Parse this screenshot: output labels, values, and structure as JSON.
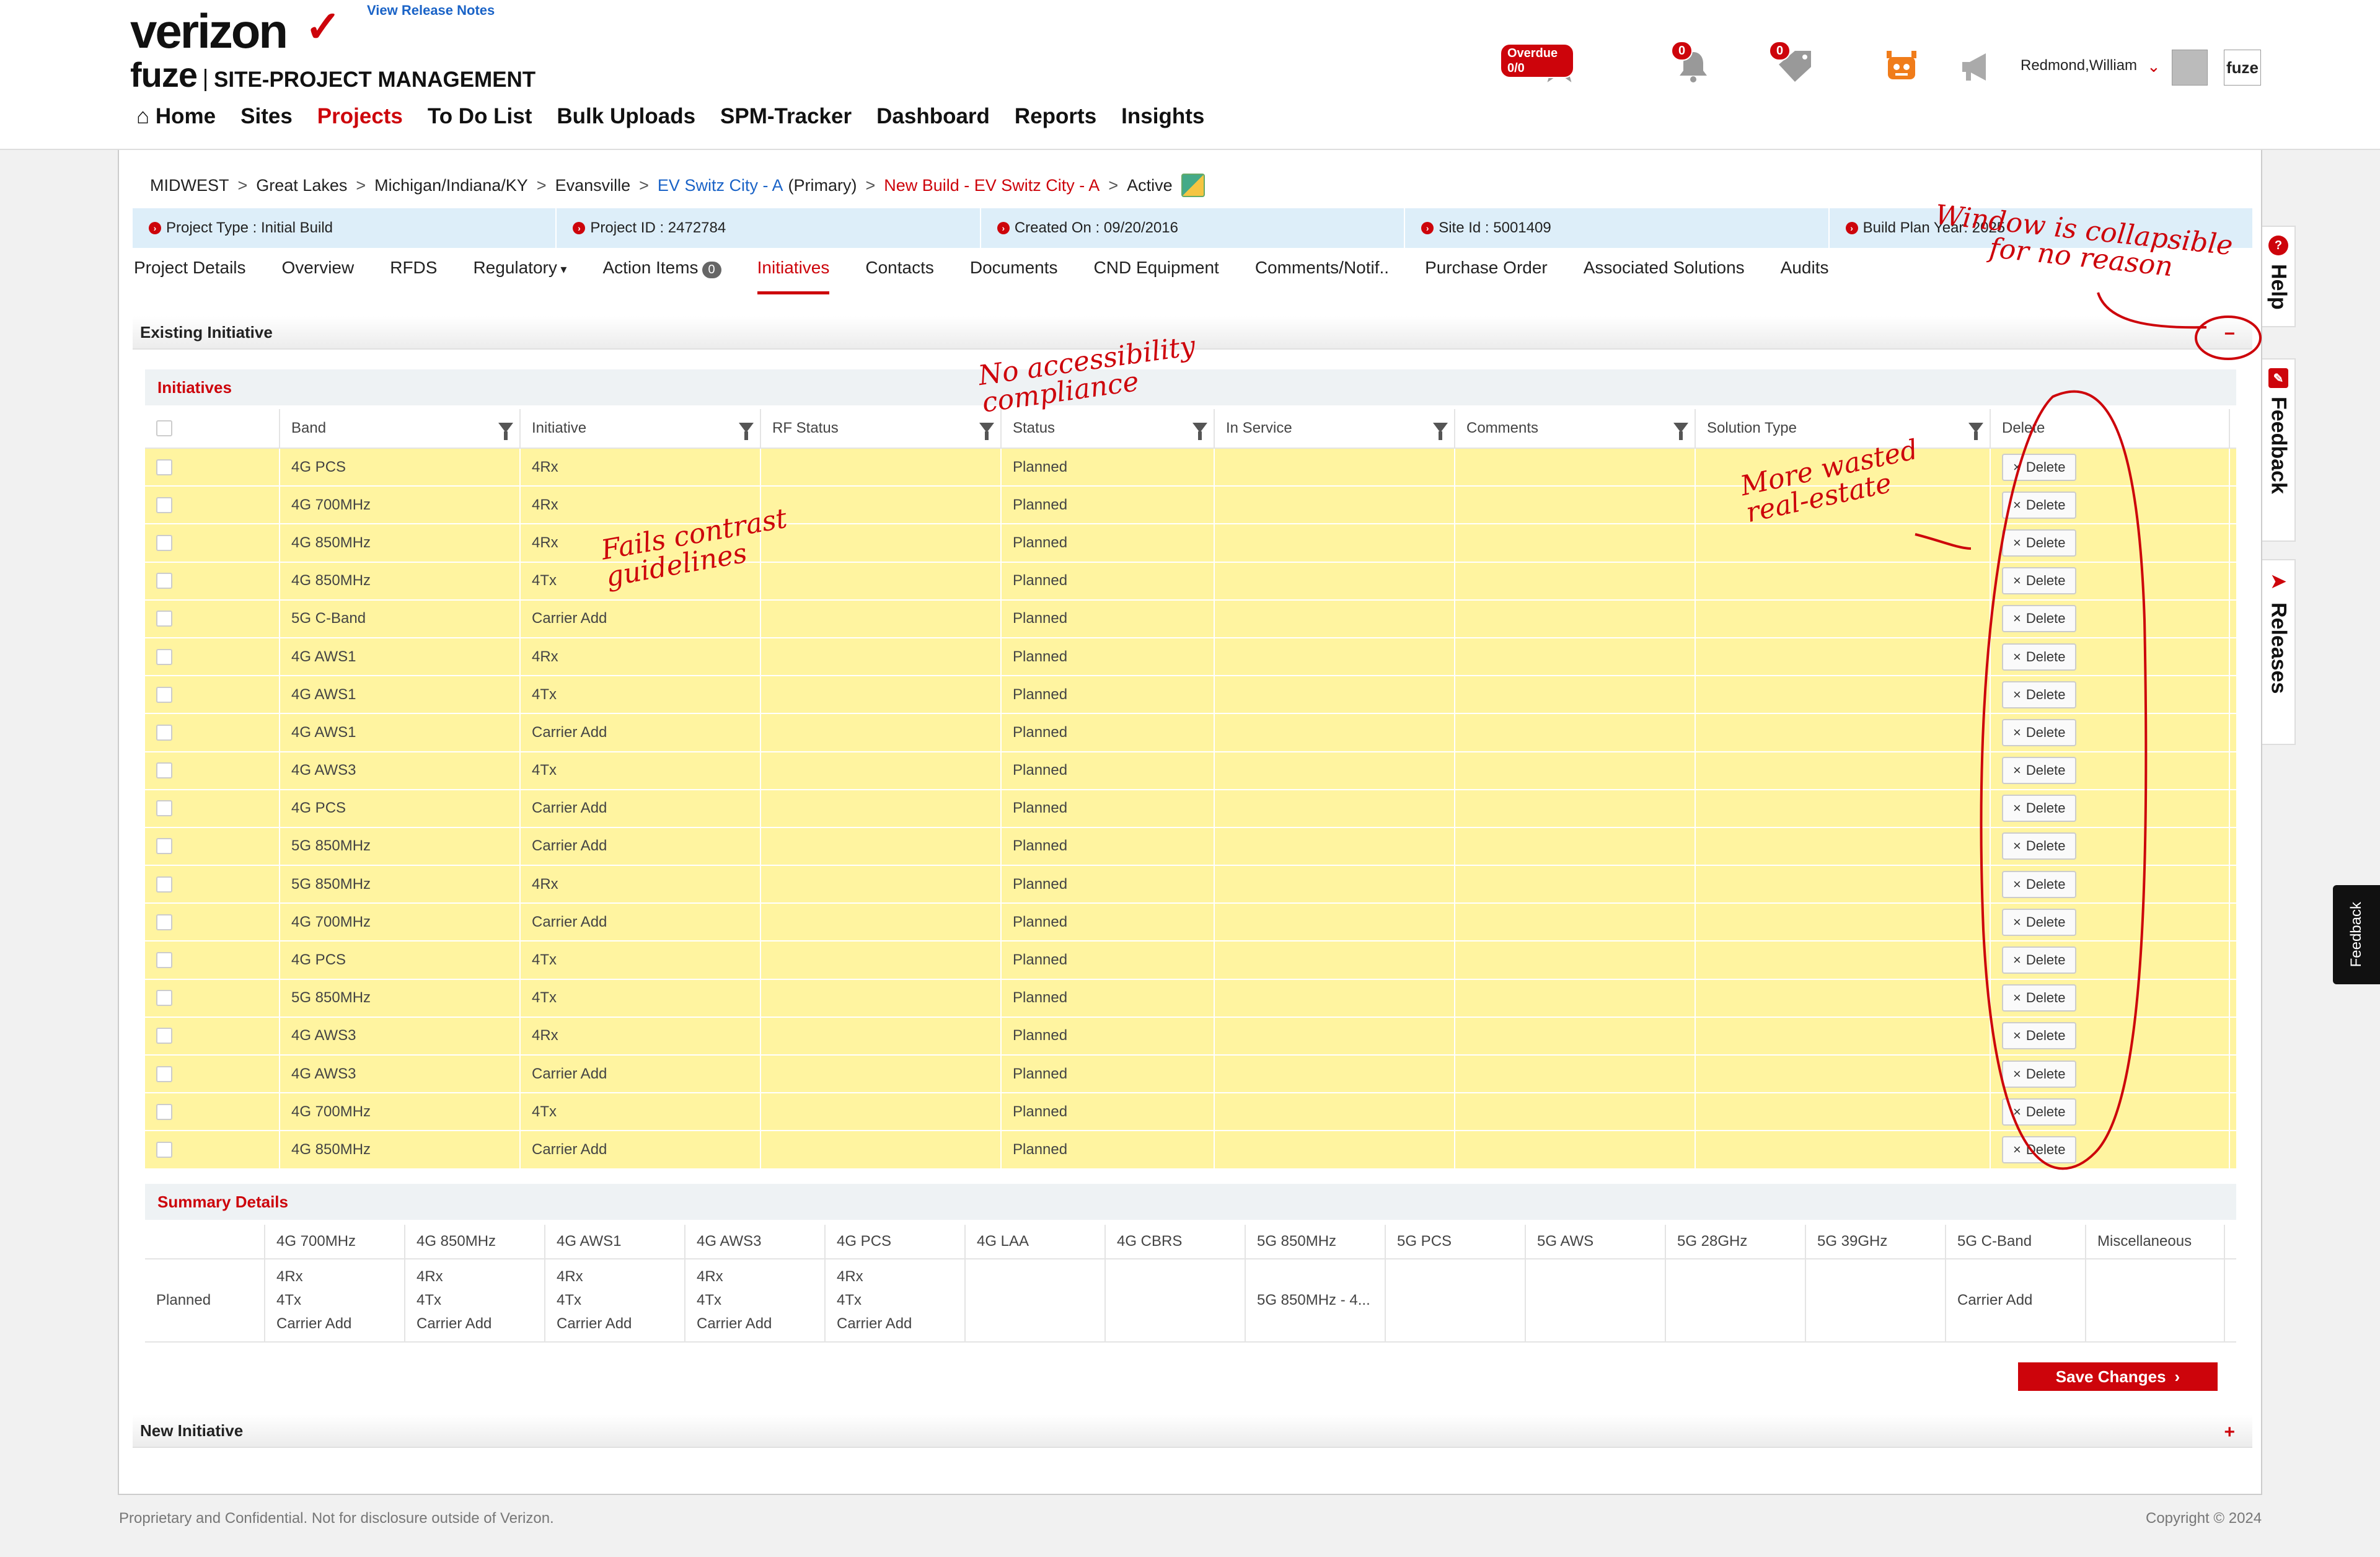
{
  "header": {
    "logo_brand": "verizon",
    "logo_product": "fuze",
    "logo_title": "SITE-PROJECT MANAGEMENT",
    "release_notes": "View Release Notes",
    "overdue_badge": "Overdue 0/0",
    "notif_count": "0",
    "tasks_count": "0",
    "user_name": "Redmond,William",
    "fuze_button": "fuze"
  },
  "nav": {
    "items": [
      "Home",
      "Sites",
      "Projects",
      "To Do List",
      "Bulk Uploads",
      "SPM-Tracker",
      "Dashboard",
      "Reports",
      "Insights"
    ],
    "active": "Projects"
  },
  "breadcrumb": {
    "items": [
      "MIDWEST",
      "Great Lakes",
      "Michigan/Indiana/KY",
      "Evansville"
    ],
    "site_link": "EV Switz City - A",
    "site_suffix": "(Primary)",
    "project_link": "New Build - EV Switz City - A",
    "status": "Active"
  },
  "info": {
    "project_type": "Project Type : Initial Build",
    "project_id": "Project ID : 2472784",
    "created_on": "Created On : 09/20/2016",
    "site_id": "Site Id : 5001409",
    "build_plan_year": "Build Plan Year: 2025"
  },
  "tabs": {
    "items": [
      "Project Details",
      "Overview",
      "RFDS",
      "Regulatory",
      "Action Items",
      "Initiatives",
      "Contacts",
      "Documents",
      "CND Equipment",
      "Comments/Notif..",
      "Purchase Order",
      "Associated Solutions",
      "Audits"
    ],
    "action_items_count": "0",
    "active": "Initiatives"
  },
  "existing_initiative": {
    "title": "Existing Initiative",
    "collapse_symbol": "−"
  },
  "initiatives": {
    "title": "Initiatives",
    "columns": [
      "Band",
      "Initiative",
      "RF Status",
      "Status",
      "In Service",
      "Comments",
      "Solution Type",
      "Delete"
    ],
    "delete_label": "Delete",
    "rows": [
      {
        "band": "4G PCS",
        "initiative": "4Rx",
        "status": "Planned"
      },
      {
        "band": "4G 700MHz",
        "initiative": "4Rx",
        "status": "Planned"
      },
      {
        "band": "4G 850MHz",
        "initiative": "4Rx",
        "status": "Planned"
      },
      {
        "band": "4G 850MHz",
        "initiative": "4Tx",
        "status": "Planned"
      },
      {
        "band": "5G C-Band",
        "initiative": "Carrier Add",
        "status": "Planned"
      },
      {
        "band": "4G AWS1",
        "initiative": "4Rx",
        "status": "Planned"
      },
      {
        "band": "4G AWS1",
        "initiative": "4Tx",
        "status": "Planned"
      },
      {
        "band": "4G AWS1",
        "initiative": "Carrier Add",
        "status": "Planned"
      },
      {
        "band": "4G AWS3",
        "initiative": "4Tx",
        "status": "Planned"
      },
      {
        "band": "4G PCS",
        "initiative": "Carrier Add",
        "status": "Planned"
      },
      {
        "band": "5G 850MHz",
        "initiative": "Carrier Add",
        "status": "Planned"
      },
      {
        "band": "5G 850MHz",
        "initiative": "4Rx",
        "status": "Planned"
      },
      {
        "band": "4G 700MHz",
        "initiative": "Carrier Add",
        "status": "Planned"
      },
      {
        "band": "4G PCS",
        "initiative": "4Tx",
        "status": "Planned"
      },
      {
        "band": "5G 850MHz",
        "initiative": "4Tx",
        "status": "Planned"
      },
      {
        "band": "4G AWS3",
        "initiative": "4Rx",
        "status": "Planned"
      },
      {
        "band": "4G AWS3",
        "initiative": "Carrier Add",
        "status": "Planned"
      },
      {
        "band": "4G 700MHz",
        "initiative": "4Tx",
        "status": "Planned"
      },
      {
        "band": "4G 850MHz",
        "initiative": "Carrier Add",
        "status": "Planned"
      }
    ]
  },
  "summary": {
    "title": "Summary Details",
    "columns": [
      "4G 700MHz",
      "4G 850MHz",
      "4G AWS1",
      "4G AWS3",
      "4G PCS",
      "4G LAA",
      "4G CBRS",
      "5G 850MHz",
      "5G PCS",
      "5G AWS",
      "5G 28GHz",
      "5G 39GHz",
      "5G C-Band",
      "Miscellaneous"
    ],
    "row_label": "Planned",
    "cells": [
      [
        "4Rx",
        "4Tx",
        "Carrier Add"
      ],
      [
        "4Rx",
        "4Tx",
        "Carrier Add"
      ],
      [
        "4Rx",
        "4Tx",
        "Carrier Add"
      ],
      [
        "4Rx",
        "4Tx",
        "Carrier Add"
      ],
      [
        "4Rx",
        "4Tx",
        "Carrier Add"
      ],
      [],
      [],
      [
        "5G 850MHz - 4..."
      ],
      [],
      [],
      [],
      [],
      [
        "Carrier Add"
      ],
      []
    ]
  },
  "save_button": "Save Changes",
  "new_initiative": {
    "title": "New Initiative",
    "expand_symbol": "+"
  },
  "footer": {
    "left": "Proprietary and Confidential. Not for disclosure outside of Verizon.",
    "right": "Copyright © 2024"
  },
  "side_tabs": {
    "help": "Help",
    "feedback": "Feedback",
    "releases": "Releases"
  },
  "feedback_tab": "Feedback",
  "annotations": {
    "window_collapsible": "Window is collapsible for no reason",
    "no_accessibility": "No accessibility compliance",
    "fails_contrast": "Fails contrast guidelines",
    "wasted_space": "More wasted real-estate"
  },
  "colors": {
    "brand_red": "#cd040b",
    "row_yellow": "#fff4a0",
    "link_blue": "#1a63c7"
  }
}
